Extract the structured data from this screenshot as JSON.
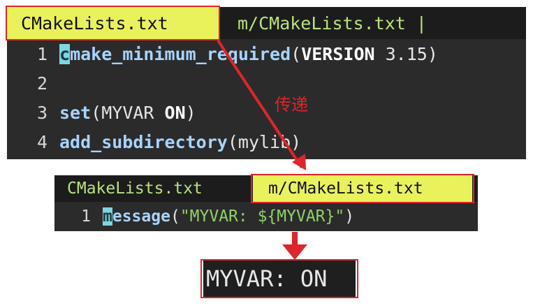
{
  "editor1": {
    "tabs": [
      {
        "label": "CMakeLists.txt",
        "active": true
      },
      {
        "label": "m/CMakeLists.txt |",
        "active": false
      }
    ],
    "lines": [
      {
        "n": "1",
        "cursor": "c",
        "kw": "make_minimum_required",
        "open": "(",
        "bold": "VERSION",
        "rest": " 3.15",
        "close": ")"
      },
      {
        "n": "2"
      },
      {
        "n": "3",
        "kw": "set",
        "open": "(",
        "plain": "MYVAR ",
        "bold": "ON",
        "close": ")"
      },
      {
        "n": "4",
        "kw": "add_subdirectory",
        "open": "(",
        "plain": "mylib",
        "close": ")"
      }
    ]
  },
  "annotation": {
    "text": "传递"
  },
  "editor2": {
    "tabs": [
      {
        "label": "CMakeLists.txt",
        "active": false
      },
      {
        "label": "m/CMakeLists.txt",
        "active": true
      }
    ],
    "line": {
      "n": "1",
      "cursor": "m",
      "kw": "essage",
      "open": "(",
      "str": "\"MYVAR: ${MYVAR}\"",
      "close": ")"
    }
  },
  "output": {
    "text": "MYVAR: ON"
  },
  "colors": {
    "accent_red": "#e0242b",
    "tab_active": "#e9f25a",
    "editor_bg": "#2b2b2b"
  }
}
